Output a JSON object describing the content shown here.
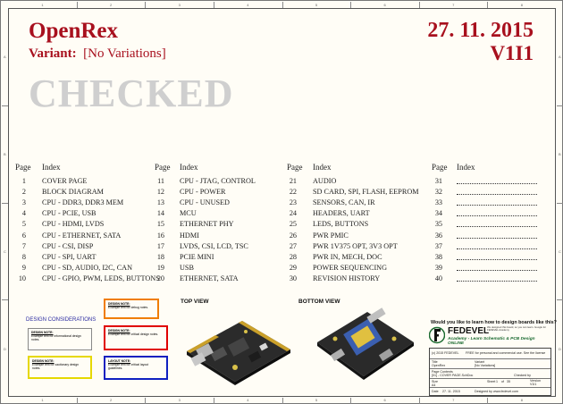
{
  "sheet": {
    "title": "OpenRex",
    "variant_label": "Variant:",
    "variant_value": "[No Variations]",
    "stamp": "CHECKED",
    "date": "27. 11. 2015",
    "version": "V1I1",
    "zones_top": [
      "1",
      "2",
      "3",
      "4",
      "5",
      "6",
      "7",
      "8"
    ],
    "zones_side": [
      "A",
      "B",
      "C",
      "D"
    ]
  },
  "index": {
    "col_page_header": "Page",
    "col_index_header": "Index",
    "columns": [
      [
        {
          "page": "1",
          "name": "COVER PAGE"
        },
        {
          "page": "2",
          "name": "BLOCK DIAGRAM"
        },
        {
          "page": "3",
          "name": "CPU - DDR3, DDR3 MEM"
        },
        {
          "page": "4",
          "name": "CPU - PCIE, USB"
        },
        {
          "page": "5",
          "name": "CPU - HDMI, LVDS"
        },
        {
          "page": "6",
          "name": "CPU - ETHERNET, SATA"
        },
        {
          "page": "7",
          "name": "CPU - CSI, DISP"
        },
        {
          "page": "8",
          "name": "CPU - SPI, UART"
        },
        {
          "page": "9",
          "name": "CPU - SD, AUDIO, I2C, CAN"
        },
        {
          "page": "10",
          "name": "CPU - GPIO, PWM, LEDS, BUTTONS"
        }
      ],
      [
        {
          "page": "11",
          "name": "CPU - JTAG, CONTROL"
        },
        {
          "page": "12",
          "name": "CPU - POWER"
        },
        {
          "page": "13",
          "name": "CPU - UNUSED"
        },
        {
          "page": "14",
          "name": "MCU"
        },
        {
          "page": "15",
          "name": "ETHERNET PHY"
        },
        {
          "page": "16",
          "name": "HDMI"
        },
        {
          "page": "17",
          "name": "LVDS, CSI, LCD, TSC"
        },
        {
          "page": "18",
          "name": "PCIE MINI"
        },
        {
          "page": "19",
          "name": "USB"
        },
        {
          "page": "20",
          "name": "ETHERNET, SATA"
        }
      ],
      [
        {
          "page": "21",
          "name": "AUDIO"
        },
        {
          "page": "22",
          "name": "SD CARD, SPI, FLASH, EEPROM"
        },
        {
          "page": "23",
          "name": "SENSORS, CAN, IR"
        },
        {
          "page": "24",
          "name": "HEADERS, UART"
        },
        {
          "page": "25",
          "name": "LEDS, BUTTONS"
        },
        {
          "page": "26",
          "name": "PWR PMIC"
        },
        {
          "page": "27",
          "name": "PWR 1V375 OPT, 3V3 OPT"
        },
        {
          "page": "28",
          "name": "PWR IN, MECH, DOC"
        },
        {
          "page": "29",
          "name": "POWER SEQUENCING"
        },
        {
          "page": "30",
          "name": "REVISION HISTORY"
        }
      ],
      [
        {
          "page": "31",
          "name": ""
        },
        {
          "page": "32",
          "name": ""
        },
        {
          "page": "33",
          "name": ""
        },
        {
          "page": "34",
          "name": ""
        },
        {
          "page": "35",
          "name": ""
        },
        {
          "page": "36",
          "name": ""
        },
        {
          "page": "37",
          "name": ""
        },
        {
          "page": "38",
          "name": ""
        },
        {
          "page": "39",
          "name": ""
        },
        {
          "page": "40",
          "name": ""
        }
      ]
    ]
  },
  "design": {
    "title": "DESIGN CONSIDERATIONS",
    "notes": [
      {
        "heading": "DESIGN NOTE:",
        "text": "Example text for debug notes.",
        "color": "#f07d00"
      },
      {
        "heading": "DESIGN NOTE:",
        "text": "Example text for informational design notes.",
        "color": "#888888"
      },
      {
        "heading": "DESIGN NOTE:",
        "text": "Example text for critical design notes.",
        "color": "#e00000"
      },
      {
        "heading": "DESIGN NOTE:",
        "text": "Example text for cautionary design notes.",
        "color": "#e6d800"
      },
      {
        "heading": "LAYOUT NOTE:",
        "text": "Example text for critical layout guidelines.",
        "color": "#1020c0"
      }
    ]
  },
  "views": {
    "top_label": "TOP VIEW",
    "bottom_label": "BOTTOM VIEW"
  },
  "promo": {
    "question": "Would you like to learn how to design boards like this?",
    "brand": "FEDEVEL",
    "tagline": "Academy - Learn Schematic & PCB Design ONLINE",
    "small": "We designed this board, so you can learn. Google for FEDEVEL Academy"
  },
  "title_block": {
    "copyright": "(c) 2015 FEDEVEL",
    "license": "FREE for personal and commercial use. See the license",
    "title_label": "Title",
    "title_value": "OpenRex",
    "variant_label": "Variant",
    "variant_value": "[No Variations]",
    "page_contents_label": "Page Contents",
    "page_contents_value": "[01] - COVER PAGE.SchDoc",
    "checked_label": "Checked by",
    "size_label": "Size",
    "size_value": "A4",
    "sheet_label": "Sheet",
    "sheet_value": "1",
    "of_label": "of",
    "of_value": "35",
    "date_label": "Date",
    "date_value": "27. 11. 2015",
    "website": "Designed by www.fedevel.com",
    "version_label": "Version",
    "version_value": "V1I1"
  }
}
